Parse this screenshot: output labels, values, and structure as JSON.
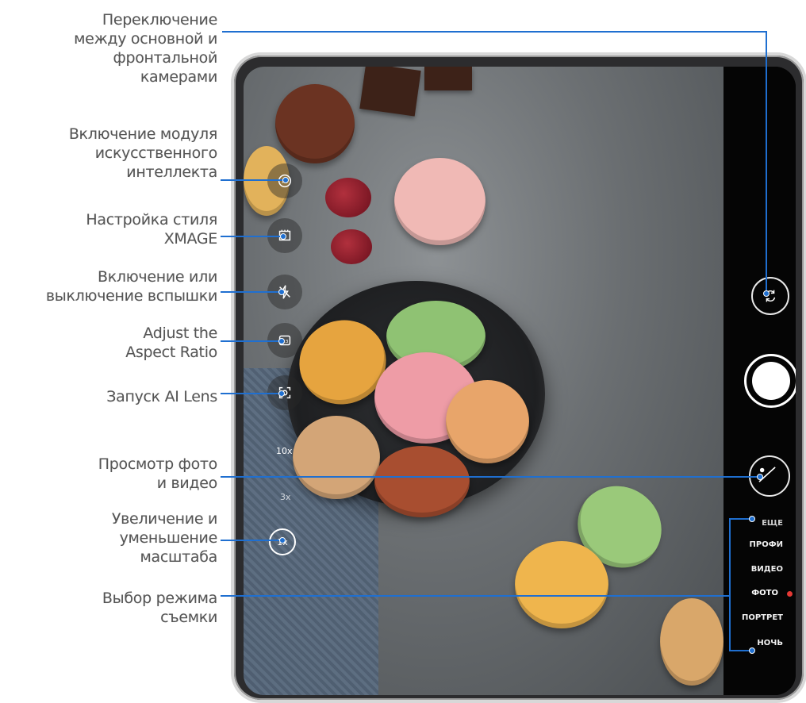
{
  "callouts": {
    "switch_camera": [
      "Переключение",
      "между основной и",
      "фронтальной",
      "камерами"
    ],
    "ai_module": [
      "Включение модуля",
      "искусственного",
      "интеллекта"
    ],
    "xmage_style": [
      "Настройка стиля",
      "XMAGE"
    ],
    "flash": [
      "Включение или",
      "выключение вспышки"
    ],
    "aspect_ratio": [
      "Adjust the",
      "Aspect Ratio"
    ],
    "ai_lens": [
      "Запуск AI Lens"
    ],
    "gallery": [
      "Просмотр фото",
      "и видео"
    ],
    "zoom": [
      "Увеличение и",
      "уменьшение",
      "масштаба"
    ],
    "modes": [
      "Выбор режима",
      "съемки"
    ]
  },
  "zoom_levels": {
    "top": "10x",
    "mid": "3x",
    "current": "1x"
  },
  "camera_modes": [
    {
      "label": "ЕЩЕ"
    },
    {
      "label": "ПРОФИ"
    },
    {
      "label": "ВИДЕО"
    },
    {
      "label": "ФОТО",
      "active": true
    },
    {
      "label": "ПОРТРЕТ"
    },
    {
      "label": "НОЧЬ"
    }
  ],
  "colors": {
    "callout_line": "#1f6fd0",
    "active_mode_dot": "#e53935",
    "label_text": "#555555"
  },
  "icons": {
    "ai": "ai-icon",
    "xmage": "xmage-style-icon",
    "flash": "flash-off-icon",
    "aspect": "aspect-ratio-icon",
    "lens": "ai-lens-icon",
    "switch": "camera-switch-icon",
    "shutter": "shutter-icon",
    "gallery": "gallery-thumbnail-icon"
  }
}
